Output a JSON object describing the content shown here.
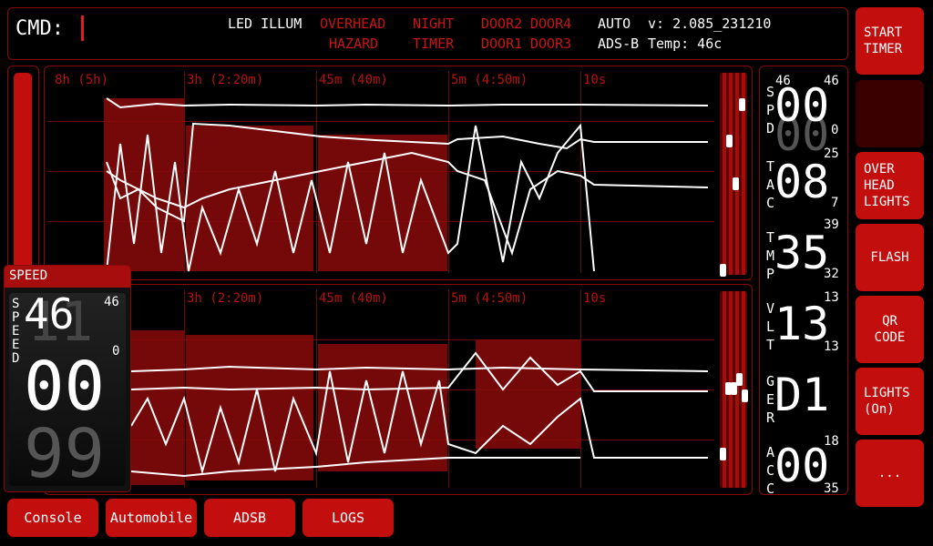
{
  "topbar": {
    "cmd_label": "CMD:",
    "led_illum": "LED ILLUM",
    "overhead": "OVERHEAD",
    "hazard": "HAZARD",
    "night": "NIGHT",
    "timer": "TIMER",
    "door2": "DOOR2",
    "door4": "DOOR4",
    "door1": "DOOR1",
    "door3": "DOOR3",
    "auto": "AUTO",
    "adsb": "ADS-B",
    "version": "v: 2.085_231210",
    "temp": "Temp: 46c"
  },
  "right_buttons": {
    "start_timer": "START\nTIMER",
    "overhead_lights": "OVER\nHEAD\nLIGHTS",
    "flash": "FLASH",
    "qr_code": "QR\nCODE",
    "lights_on": "LIGHTS\n(On)",
    "more": "..."
  },
  "tabs": {
    "console": "Console",
    "automobile": "Automobile",
    "adsb": "ADSB",
    "logs": "LOGS"
  },
  "charts": {
    "top_ticks": [
      "8h (5h)",
      "3h (2:20m)",
      "45m (40m)",
      "5m (4:50m)",
      "10s"
    ],
    "bottom_ticks": [
      "3h (2:20m)",
      "45m (40m)",
      "5m (4:50m)",
      "10s"
    ]
  },
  "readouts": {
    "spd": {
      "letters": "S\nP\nD",
      "max": "46",
      "value": "00",
      "min": "0",
      "ghost_left": "46"
    },
    "tac": {
      "letters": "T\nA\nC",
      "max": "25",
      "value": "08",
      "min": "7"
    },
    "tmp": {
      "letters": "T\nM\nP",
      "max": "39",
      "value": "35",
      "min": "32"
    },
    "vlt": {
      "letters": "V\nL\nT",
      "max": "13",
      "value": "13",
      "min": "13"
    },
    "ger": {
      "letters": "G\nE\nR",
      "value": "D1"
    },
    "acc": {
      "letters": "A\nC\nC",
      "max": "18",
      "value": "00",
      "min": "35"
    }
  },
  "speed_overlay": {
    "title": "SPEED",
    "letters": "S\nP\nE\nE\nD",
    "top_value": "46",
    "max": "46",
    "min": "0",
    "value": "00",
    "ghost_above": "11",
    "ghost_below": "99"
  },
  "colors": {
    "accent": "#c30e0e",
    "grid": "#6a0808",
    "tick_text": "#b81010",
    "trace": "#ffffff"
  }
}
